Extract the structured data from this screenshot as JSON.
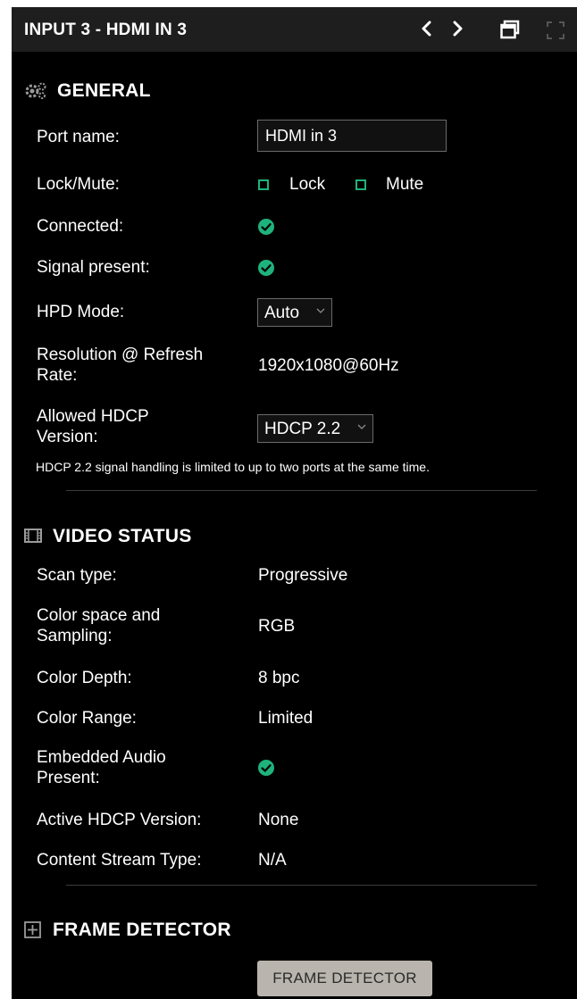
{
  "header": {
    "title": "INPUT 3 - HDMI IN 3"
  },
  "general": {
    "title": "GENERAL",
    "port_name_label": "Port name:",
    "port_name_value": "HDMI in 3",
    "lock_mute_label": "Lock/Mute:",
    "lock_label": "Lock",
    "mute_label": "Mute",
    "connected_label": "Connected:",
    "signal_present_label": "Signal present:",
    "hpd_mode_label": "HPD Mode:",
    "hpd_mode_value": "Auto",
    "resolution_label_line1": "Resolution @ Refresh",
    "resolution_label_line2": "Rate:",
    "resolution_value": "1920x1080@60Hz",
    "hdcp_label_line1": "Allowed HDCP",
    "hdcp_label_line2": "Version:",
    "hdcp_value": "HDCP 2.2",
    "hdcp_note": "HDCP 2.2 signal handling is limited to up to two ports at the same time."
  },
  "video_status": {
    "title": "VIDEO STATUS",
    "scan_type_label": "Scan type:",
    "scan_type_value": "Progressive",
    "color_space_label_line1": "Color space and",
    "color_space_label_line2": "Sampling:",
    "color_space_value": "RGB",
    "color_depth_label": "Color Depth:",
    "color_depth_value": "8 bpc",
    "color_range_label": "Color Range:",
    "color_range_value": "Limited",
    "embedded_audio_label_line1": "Embedded Audio",
    "embedded_audio_label_line2": "Present:",
    "active_hdcp_label": "Active HDCP Version:",
    "active_hdcp_value": "None",
    "content_stream_label": "Content Stream Type:",
    "content_stream_value": "N/A"
  },
  "frame_detector": {
    "title": "FRAME DETECTOR",
    "button_label": "FRAME DETECTOR"
  },
  "colors": {
    "panel_bg": "#000000",
    "header_bg": "#1e1e1e",
    "accent_green": "#1fb37c",
    "button_bg": "#b9b4ad"
  },
  "icons": {
    "prev": "chevron-left-icon",
    "next": "chevron-right-icon",
    "window": "window-restore-icon",
    "fullscreen": "fullscreen-icon",
    "general": "gears-icon",
    "video_status": "film-icon",
    "frame_detector": "frame-expand-icon",
    "status_ok": "check-circle-icon"
  }
}
